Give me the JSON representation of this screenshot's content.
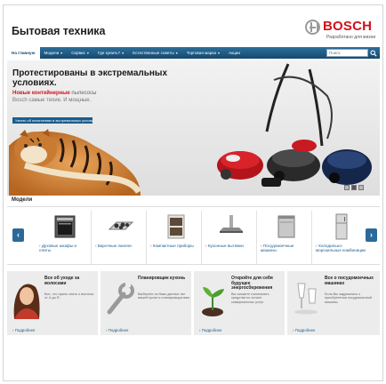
{
  "header": {
    "site_title": "Бытовая техника",
    "brand": "BOSCH",
    "brand_tagline": "Разработано для жизни"
  },
  "nav": {
    "items": [
      {
        "label": "На главную",
        "active": true
      },
      {
        "label": "Модели",
        "has_dropdown": true
      },
      {
        "label": "Сервис",
        "has_dropdown": true
      },
      {
        "label": "Где купить?",
        "has_dropdown": true
      },
      {
        "label": "Естественные советы",
        "has_dropdown": true
      },
      {
        "label": "Торговая марка",
        "has_dropdown": true
      },
      {
        "label": "Акции",
        "has_dropdown": false
      }
    ],
    "search_placeholder": "Поиск"
  },
  "hero": {
    "title": "Протестированы в экстремальных условиях.",
    "sub_red": "Новые контейнерные",
    "sub_gray": " пылесосы",
    "sub_line2": "Bosch самые тихие. И мощные.",
    "button": "Узнать об испытаниях в экстремальных условиях",
    "slides": [
      "1",
      "2",
      "3"
    ],
    "active_slide": 1
  },
  "models": {
    "label": "Модели",
    "products": [
      {
        "label": "Духовые шкафы и плиты",
        "icon": "oven-icon"
      },
      {
        "label": "Варочные панели",
        "icon": "hob-icon"
      },
      {
        "label": "Компактные приборы",
        "icon": "compact-appliance-icon"
      },
      {
        "label": "Кухонные вытяжки",
        "icon": "hood-icon"
      },
      {
        "label": "Посудомоечные машины",
        "icon": "dishwasher-icon"
      },
      {
        "label": "Холодильно-морозильные комбинации",
        "icon": "fridge-icon"
      }
    ]
  },
  "promos": [
    {
      "title": "Все об уходе за волосами",
      "text": "Все, что нужно знать о волосах от А до Я.",
      "link": "Подробнее",
      "icon": "woman-portrait-icon"
    },
    {
      "title": "Планировщик кухонь",
      "text": "Выберите из базы данных тип вашей кухни и планировщик вам",
      "link": "Подробнее",
      "icon": "wrench-icon"
    },
    {
      "title": "Откройте для себя будущее энергосбережения",
      "text": "Вы сможете сэкономить средства по оплате коммунальных услуг",
      "link": "Подробнее",
      "icon": "sprout-icon"
    },
    {
      "title": "Все о посудомоечных машинах",
      "text": "Если Вы задумались о приобретении посудомоечной машины",
      "link": "Подробнее",
      "icon": "glassware-icon"
    }
  ],
  "colors": {
    "brand_red": "#d0121b",
    "nav_blue": "#1d5a87",
    "link_blue": "#1b5d8c"
  }
}
